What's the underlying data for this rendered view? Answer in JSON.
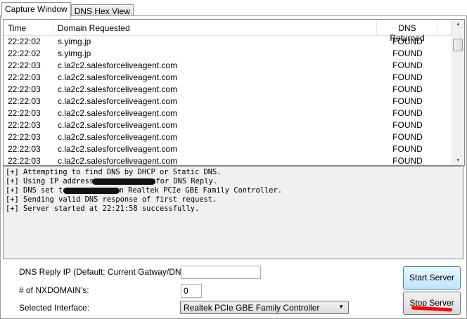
{
  "tabs": [
    {
      "label": "Capture Window"
    },
    {
      "label": "DNS Hex View"
    }
  ],
  "list": {
    "headers": [
      "Time",
      "Domain Requested",
      "DNS Returned"
    ],
    "rows": [
      [
        "22:22:02",
        "s.yimg.jp",
        "FOUND"
      ],
      [
        "22:22:02",
        "s.yimg.jp",
        "FOUND"
      ],
      [
        "22:22:03",
        "c.la2c2.salesforceliveagent.com",
        "FOUND"
      ],
      [
        "22:22:03",
        "c.la2c2.salesforceliveagent.com",
        "FOUND"
      ],
      [
        "22:22:03",
        "c.la2c2.salesforceliveagent.com",
        "FOUND"
      ],
      [
        "22:22:03",
        "c.la2c2.salesforceliveagent.com",
        "FOUND"
      ],
      [
        "22:22:03",
        "c.la2c2.salesforceliveagent.com",
        "FOUND"
      ],
      [
        "22:22:03",
        "c.la2c2.salesforceliveagent.com",
        "FOUND"
      ],
      [
        "22:22:03",
        "c.la2c2.salesforceliveagent.com",
        "FOUND"
      ],
      [
        "22:22:03",
        "c.la2c2.salesforceliveagent.com",
        "FOUND"
      ],
      [
        "22:22:03",
        "c.la2c2.salesforceliveagent.com",
        "FOUND"
      ]
    ]
  },
  "log": {
    "line1": "[+] Attempting to find DNS by DHCP or Static DNS.",
    "line2_a": "[+] Using IP address ",
    "line2_b": "for DNS Reply.",
    "line3_a": "[+] DNS set to",
    "line3_b": "n Realtek PCIe GBE Family Controller.",
    "line4": "[+] Sending valid DNS response of first request.",
    "line5": "[+] Server started at 22:21:58 successfully."
  },
  "form": {
    "dns_reply_label": "DNS Reply IP (Default: Current Gatway/DNS):",
    "dns_reply_value": "",
    "nxdomain_label": "# of NXDOMAIN's:",
    "nxdomain_value": "0",
    "interface_label": "Selected Interface:",
    "interface_value": "Realtek PCIe GBE Family Controller"
  },
  "buttons": {
    "start": "Start Server",
    "stop": "Stop Server"
  }
}
